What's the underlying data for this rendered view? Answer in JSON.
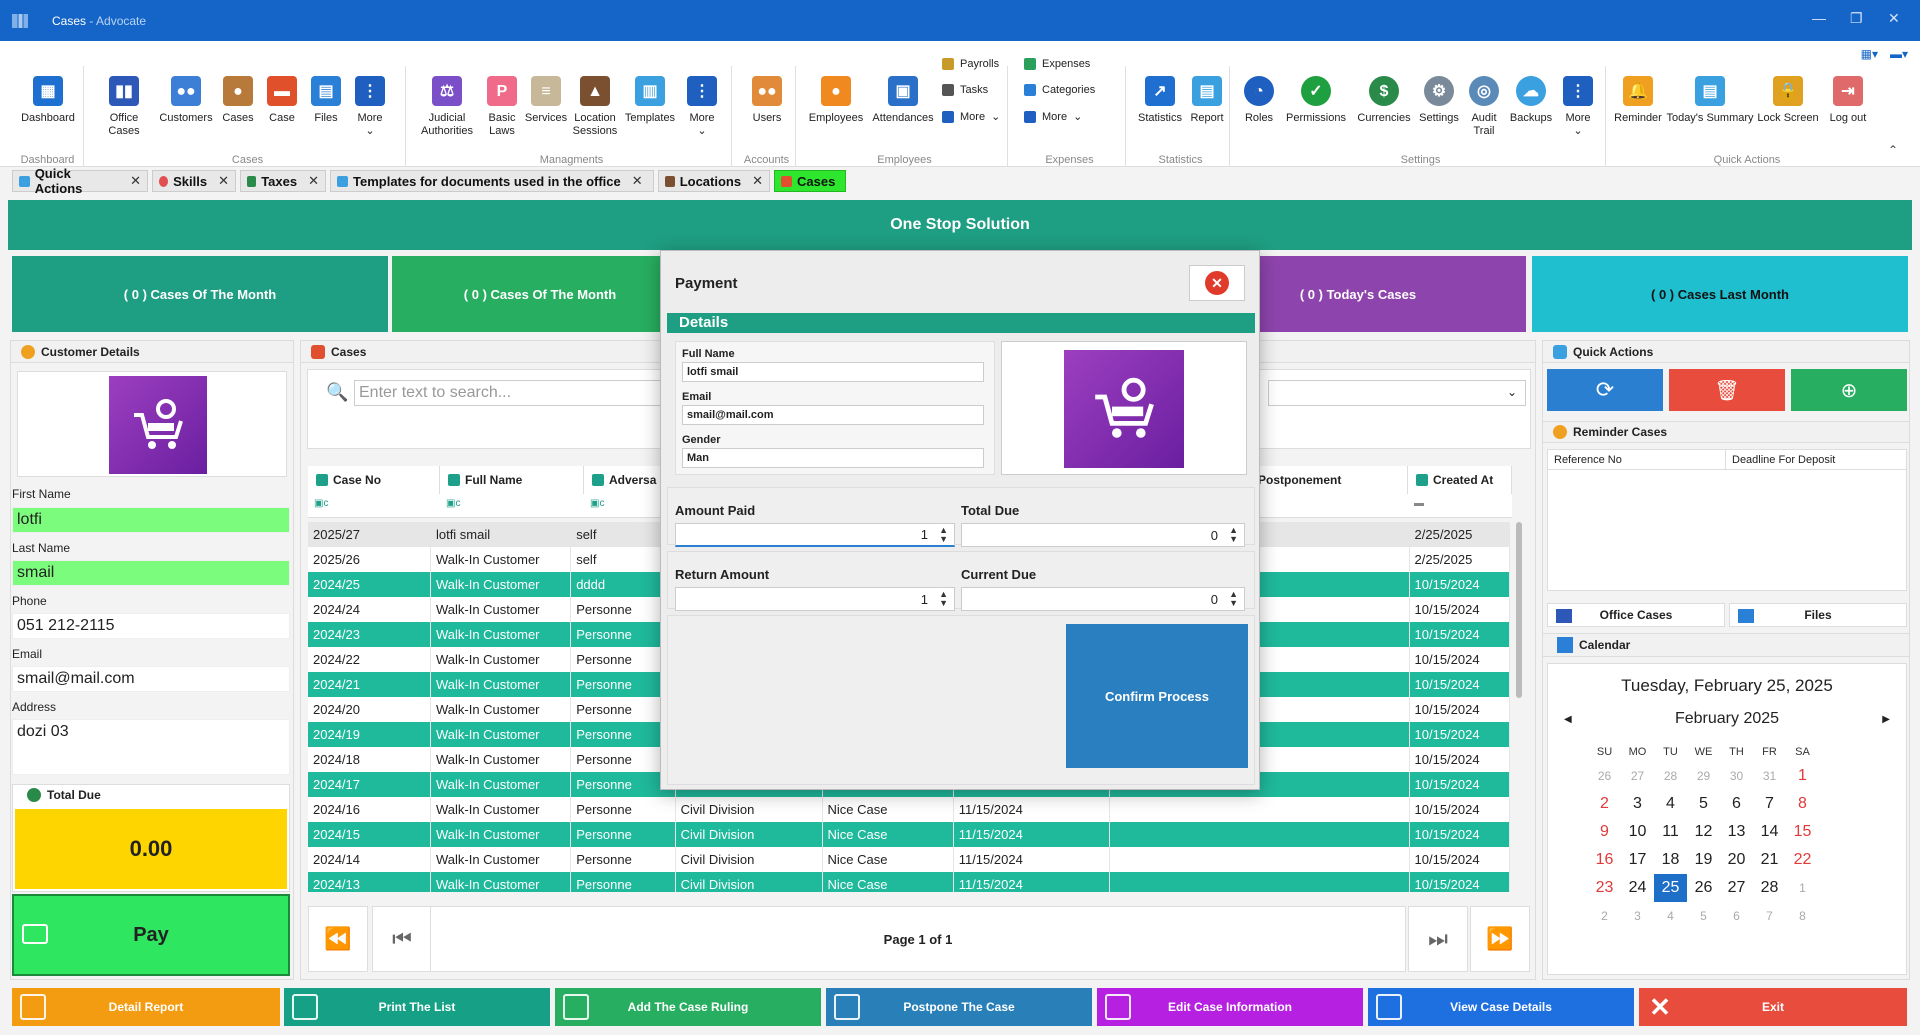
{
  "window": {
    "title": "Cases",
    "subtitle": "- Advocate"
  },
  "ribbon": {
    "groups": {
      "dashboard": "Dashboard",
      "cases": "Cases",
      "managments": "Managments",
      "accounts": "Accounts",
      "employees": "Employees",
      "expenses": "Expenses",
      "statistics": "Statistics",
      "settings": "Settings",
      "quick_actions": "Quick Actions"
    },
    "buttons": {
      "dashboard": "Dashboard",
      "office_cases": "Office Cases",
      "customers": "Customers",
      "cases": "Cases",
      "case": "Case",
      "files": "Files",
      "more1": "More",
      "judicial": "Judicial Authorities",
      "basic_laws": "Basic Laws",
      "services": "Services",
      "location_sessions": "Location Sessions",
      "templates": "Templates",
      "more2": "More",
      "users": "Users",
      "employees": "Employees",
      "attendances": "Attendances",
      "payrolls": "Payrolls",
      "tasks": "Tasks",
      "more3": "More",
      "expenses": "Expenses",
      "categories": "Categories",
      "more4": "More",
      "statistics": "Statistics",
      "report": "Report",
      "roles": "Roles",
      "permissions": "Permissions",
      "currencies": "Currencies",
      "settings": "Settings",
      "audit_trail": "Audit Trail",
      "backups": "Backups",
      "more5": "More",
      "reminder": "Reminder",
      "todays_summary": "Today's Summary",
      "lock_screen": "Lock Screen",
      "log_out": "Log out"
    }
  },
  "tabs": [
    "Quick Actions",
    "Skills",
    "Taxes",
    "Templates for documents used in the office",
    "Locations",
    "Cases"
  ],
  "banner": "One Stop Solution",
  "stats": [
    "( 0 ) Cases Of The Month",
    "( 0 ) Cases Of The Month",
    "( 0 ) Today's Cases",
    "( 0 ) Cases Last Month"
  ],
  "customer": {
    "title": "Customer Details",
    "first_name_label": "First Name",
    "first_name": "lotfi",
    "last_name_label": "Last Name",
    "last_name": "smail",
    "phone_label": "Phone",
    "phone": "051 212-2115",
    "email_label": "Email",
    "email": "smail@mail.com",
    "address_label": "Address",
    "address": "dozi 03",
    "total_due_label": "Total Due",
    "total_due": "0.00",
    "pay": "Pay"
  },
  "cases": {
    "title": "Cases",
    "search_placeholder": "Enter text to search...",
    "columns": [
      "Case No",
      "Full Name",
      "Adversa",
      "Postponement",
      "Created At"
    ],
    "rows": [
      [
        "2025/27",
        "lotfi smail",
        "self",
        "",
        "",
        "",
        "",
        "2/25/2025"
      ],
      [
        "2025/26",
        "Walk-In Customer",
        "self",
        "",
        "",
        "",
        "",
        "2/25/2025"
      ],
      [
        "2024/25",
        "Walk-In Customer",
        "dddd",
        "",
        "",
        "",
        "",
        "10/15/2024"
      ],
      [
        "2024/24",
        "Walk-In Customer",
        "Personne",
        "",
        "",
        "",
        "",
        "10/15/2024"
      ],
      [
        "2024/23",
        "Walk-In Customer",
        "Personne",
        "",
        "",
        "",
        "",
        "10/15/2024"
      ],
      [
        "2024/22",
        "Walk-In Customer",
        "Personne",
        "",
        "",
        "",
        "",
        "10/15/2024"
      ],
      [
        "2024/21",
        "Walk-In Customer",
        "Personne",
        "",
        "",
        "",
        "",
        "10/15/2024"
      ],
      [
        "2024/20",
        "Walk-In Customer",
        "Personne",
        "",
        "",
        "",
        "",
        "10/15/2024"
      ],
      [
        "2024/19",
        "Walk-In Customer",
        "Personne",
        "",
        "",
        "",
        "",
        "10/15/2024"
      ],
      [
        "2024/18",
        "Walk-In Customer",
        "Personne",
        "",
        "",
        "",
        "",
        "10/15/2024"
      ],
      [
        "2024/17",
        "Walk-In Customer",
        "Personne",
        "",
        "",
        "",
        "",
        "10/15/2024"
      ],
      [
        "2024/16",
        "Walk-In Customer",
        "Personne",
        "Civil Division",
        "Nice Case",
        "11/15/2024",
        "",
        "10/15/2024"
      ],
      [
        "2024/15",
        "Walk-In Customer",
        "Personne",
        "Civil Division",
        "Nice Case",
        "11/15/2024",
        "",
        "10/15/2024"
      ],
      [
        "2024/14",
        "Walk-In Customer",
        "Personne",
        "Civil Division",
        "Nice Case",
        "11/15/2024",
        "",
        "10/15/2024"
      ],
      [
        "2024/13",
        "Walk-In Customer",
        "Personne",
        "Civil Division",
        "Nice Case",
        "11/15/2024",
        "",
        "10/15/2024"
      ]
    ],
    "page_info": "Page 1 of 1"
  },
  "quick_actions": {
    "title": "Quick Actions",
    "reminder_title": "Reminder Cases",
    "reminder_cols": [
      "Reference No",
      "Deadline For Deposit"
    ],
    "office_cases": "Office Cases",
    "files": "Files",
    "calendar_title": "Calendar"
  },
  "calendar": {
    "long_date": "Tuesday, February 25, 2025",
    "month": "February 2025",
    "dow": [
      "SU",
      "MO",
      "TU",
      "WE",
      "TH",
      "FR",
      "SA"
    ],
    "weeks": [
      [
        "26",
        "27",
        "28",
        "29",
        "30",
        "31",
        "1"
      ],
      [
        "2",
        "3",
        "4",
        "5",
        "6",
        "7",
        "8"
      ],
      [
        "9",
        "10",
        "11",
        "12",
        "13",
        "14",
        "15"
      ],
      [
        "16",
        "17",
        "18",
        "19",
        "20",
        "21",
        "22"
      ],
      [
        "23",
        "24",
        "25",
        "26",
        "27",
        "28",
        "1"
      ],
      [
        "2",
        "3",
        "4",
        "5",
        "6",
        "7",
        "8"
      ]
    ],
    "selected": "25"
  },
  "bottom_buttons": [
    "Detail Report",
    "Print The List",
    "Add The Case Ruling",
    "Postpone The Case",
    "Edit Case Information",
    "View Case Details",
    "Exit"
  ],
  "payment": {
    "title": "Payment",
    "details": "Details",
    "full_name_label": "Full Name",
    "full_name": "lotfi smail",
    "email_label": "Email",
    "email": "smail@mail.com",
    "gender_label": "Gender",
    "gender": "Man",
    "amount_paid_label": "Amount Paid",
    "amount_paid": "1",
    "total_due_label": "Total Due",
    "total_due": "0",
    "return_amount_label": "Return Amount",
    "return_amount": "1",
    "current_due_label": "Current Due",
    "current_due": "0",
    "confirm": "Confirm Process"
  },
  "colors": {
    "accent": "#1e9e82",
    "row_alt": "#1fb99c",
    "title_bar": "#1565c8",
    "modal_button": "#2a7fc0"
  }
}
